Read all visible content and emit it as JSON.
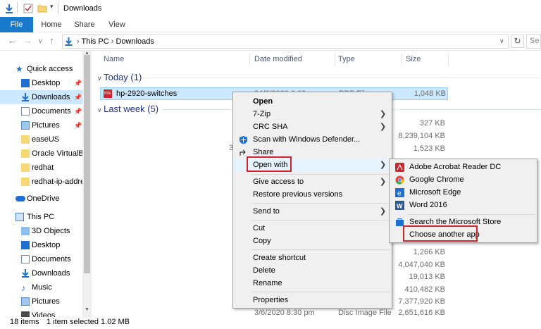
{
  "window": {
    "title": "Downloads"
  },
  "ribbon": {
    "tabs": [
      "File",
      "Home",
      "Share",
      "View"
    ]
  },
  "address": {
    "path": [
      "This PC",
      "Downloads"
    ],
    "refresh_icon": "refresh-icon"
  },
  "nav": {
    "items": [
      {
        "label": "Quick access",
        "icon": "star-icon",
        "pinned": false
      },
      {
        "label": "Desktop",
        "icon": "folder-icon",
        "pinned": true
      },
      {
        "label": "Downloads",
        "icon": "download-icon",
        "pinned": true,
        "selected": true
      },
      {
        "label": "Documents",
        "icon": "document-icon",
        "pinned": true
      },
      {
        "label": "Pictures",
        "icon": "picture-icon",
        "pinned": true
      },
      {
        "label": "easeUS",
        "icon": "folder-icon",
        "pinned": false
      },
      {
        "label": "Oracle VirtualBo",
        "icon": "folder-icon",
        "pinned": false
      },
      {
        "label": "redhat",
        "icon": "folder-icon",
        "pinned": false
      },
      {
        "label": "redhat-ip-addres",
        "icon": "folder-icon",
        "pinned": false
      },
      {
        "label": "OneDrive",
        "icon": "cloud-icon",
        "pinned": false
      },
      {
        "label": "This PC",
        "icon": "pc-icon",
        "pinned": false
      },
      {
        "label": "3D Objects",
        "icon": "cube-icon",
        "pinned": false
      },
      {
        "label": "Desktop",
        "icon": "folder-icon",
        "pinned": false
      },
      {
        "label": "Documents",
        "icon": "document-icon",
        "pinned": false
      },
      {
        "label": "Downloads",
        "icon": "download-icon",
        "pinned": false
      },
      {
        "label": "Music",
        "icon": "music-icon",
        "pinned": false
      },
      {
        "label": "Pictures",
        "icon": "picture-icon",
        "pinned": false
      },
      {
        "label": "Videos",
        "icon": "video-icon",
        "pinned": false
      }
    ]
  },
  "columns": {
    "name": "Name",
    "date": "Date modified",
    "type": "Type",
    "size": "Size"
  },
  "groups": {
    "today": "Today (1)",
    "last_week": "Last week (5)"
  },
  "files": {
    "selected": {
      "name": "hp-2920-switches",
      "date": "24/6/2020 9:09 pm",
      "type": "PDF File",
      "size": "1,048 KB"
    },
    "sizes": [
      "327 KB",
      "8,239,104 KB",
      "1,523 KB",
      "1,266 KB",
      "4,047,040 KB",
      "19,013 KB",
      "410,482 KB",
      "7,377,920 KB",
      "2,651,616 KB"
    ],
    "partial_3": "3",
    "last_row_date": "3/6/2020 8:30 pm",
    "last_row_type": "Disc Image File"
  },
  "status": {
    "count": "18 items",
    "selection": "1 item selected  1.02 MB"
  },
  "context_menu": {
    "items": {
      "open": "Open",
      "zip": "7-Zip",
      "crc": "CRC SHA",
      "defender": "Scan with Windows Defender...",
      "share": "Share",
      "open_with": "Open with",
      "give_access": "Give access to",
      "restore": "Restore previous versions",
      "send_to": "Send to",
      "cut": "Cut",
      "copy": "Copy",
      "create_shortcut": "Create shortcut",
      "delete": "Delete",
      "rename": "Rename",
      "properties": "Properties"
    }
  },
  "open_with_menu": {
    "acrobat": "Adobe Acrobat Reader DC",
    "chrome": "Google Chrome",
    "edge": "Microsoft Edge",
    "word": "Word 2016",
    "store": "Search the Microsoft Store",
    "another": "Choose another app"
  },
  "colors": {
    "accent": "#1979ca",
    "highlight": "#d0252f",
    "selection": "#cce8ff"
  }
}
